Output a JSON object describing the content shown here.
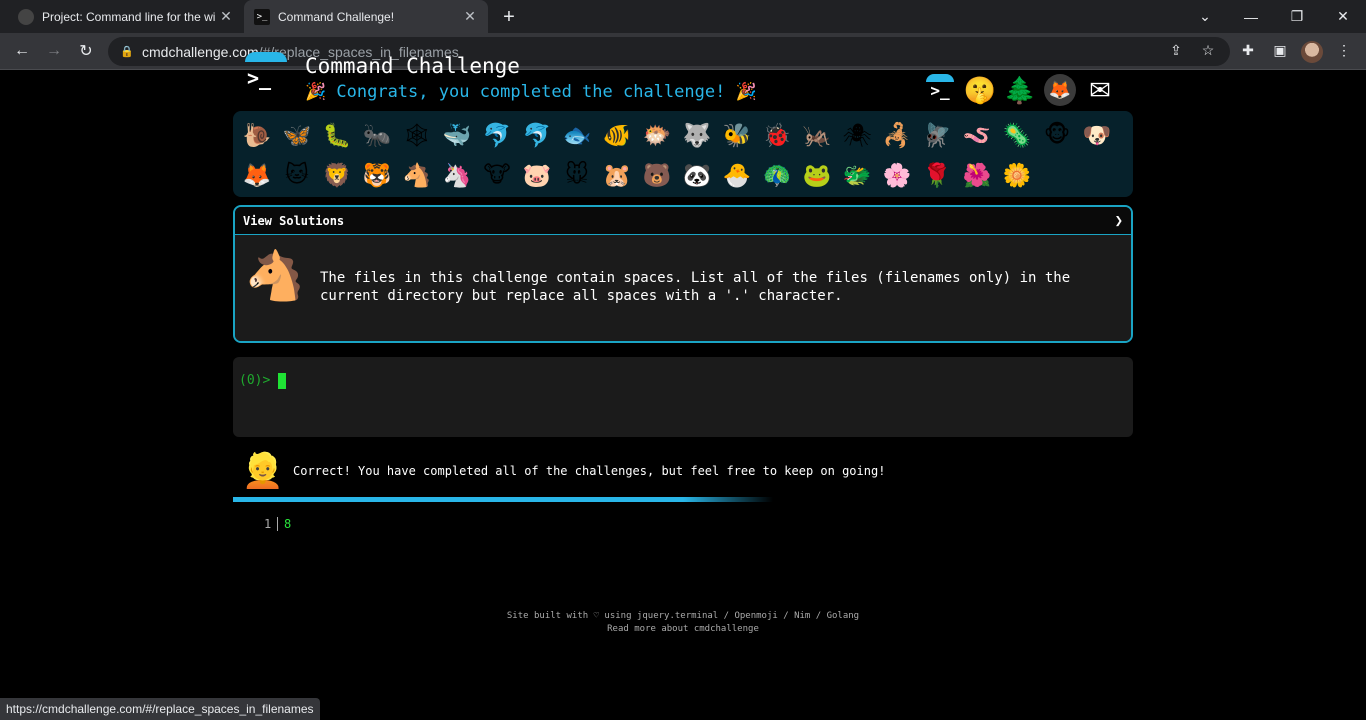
{
  "browser": {
    "tabs": [
      {
        "title": "Project: Command line for the wi",
        "favicon": "gh"
      },
      {
        "title": "Command Challenge!",
        "favicon": ">_"
      }
    ],
    "url": {
      "host": "cmdchallenge.com",
      "path": "/#/replace_spaces_in_filenames"
    },
    "status_url": "https://cmdchallenge.com/#/replace_spaces_in_filenames"
  },
  "topnav": {
    "icons": [
      {
        "name": "terminal-icon",
        "glyph": ">_"
      },
      {
        "name": "shush-face-icon",
        "glyph": "🤫"
      },
      {
        "name": "tree-icon",
        "glyph": "🌲"
      },
      {
        "name": "gitlab-icon",
        "glyph": "🦊"
      },
      {
        "name": "mail-icon",
        "glyph": "✉"
      }
    ]
  },
  "header": {
    "title": "Command Challenge",
    "congrats": "🎉 Congrats, you completed the challenge! 🎉"
  },
  "emojis": {
    "row1": [
      "🐌",
      "🦋",
      "🐛",
      "🐜",
      "🕸",
      "🐳",
      "🐬",
      "🐬",
      "🐟",
      "🐠",
      "🐡",
      "🐺",
      "🐝",
      "🐞",
      "🦗",
      "🕷",
      "🦂",
      "🪰",
      "🪱",
      "🦠",
      "🐵",
      "🐶"
    ],
    "row2": [
      "🦊",
      "🐱",
      "🦁",
      "🐯",
      "🐴",
      "🦄",
      "🐮",
      "🐷",
      "🐭",
      "🐹",
      "🐻",
      "🐼",
      "🐣",
      "🦚",
      "🐸",
      "🐲",
      "🌸",
      "🌹",
      "🌺",
      "🌼"
    ]
  },
  "solutions": {
    "header": "View Solutions",
    "chevron": "❯",
    "icon": "🐴",
    "description": "The files in this challenge contain spaces. List all of the files (filenames only) in the current directory but replace all spaces with a '.' character."
  },
  "terminal": {
    "prompt": "(0)>"
  },
  "result": {
    "icon": "👱",
    "text": "Correct! You have completed all of the challenges, but feel free to keep on going!",
    "progress": 0.55
  },
  "output": {
    "line_number": "1",
    "value": "8"
  },
  "footer": {
    "line1": "Site built with ♡ using jquery.terminal / Openmoji / Nim / Golang",
    "line2": "Read more about cmdchallenge"
  }
}
